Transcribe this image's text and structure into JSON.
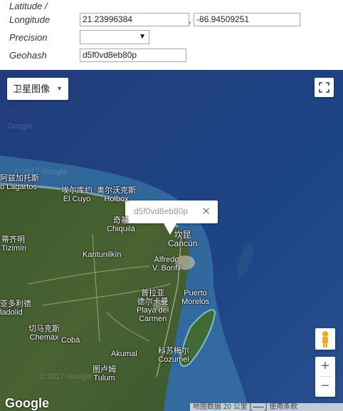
{
  "form": {
    "latlon_label_1": "Latitude /",
    "latlon_label_2": "Longitude",
    "latitude": "21.23996384",
    "longitude": "-86.94509251",
    "comma": ",",
    "precision_label": "Precision",
    "precision_value": "",
    "geohash_label": "Geohash",
    "geohash_value": "d5f0vd8eb80p"
  },
  "map": {
    "type_label": "卫星图像",
    "infowindow_text": "d5f0vd8eb80p",
    "close_glyph": "✕",
    "zoom_in": "+",
    "zoom_out": "−",
    "logo": "Google",
    "attribution": "地图数据   20 公里 ⎣⎯⎯⎯⎦   使用条款",
    "watermarks": [
      "Google",
      "© 2017 Google",
      "© 2017 Google"
    ],
    "places": {
      "p1": "阿兹加托斯",
      "p1b": "o Lagartos",
      "p2": "埃尔库约",
      "p2b": "El Cuyo",
      "p3": "奥尔沃克斯",
      "p3b": "Holbox",
      "p4": "奇基",
      "p4b": "Chiquilá",
      "p5": "坎昆",
      "p5b": "Cancún",
      "p6": "蒂齐明",
      "p6b": "Tizimín",
      "p7": "Kantunilkín",
      "p8": "Alfredo",
      "p8b": "V. Bonfil",
      "p9": "普拉亚",
      "p9b": "德尔卡曼",
      "p9c": "Playa del",
      "p9d": "Carmen",
      "p10": "Puerto",
      "p10b": "Morelos",
      "p11": "亚多利德",
      "p11b": "ladolid",
      "p12": "切马克斯",
      "p12b": "Chemax",
      "p13": "Cobá",
      "p14": "科苏梅尔",
      "p14b": "Cozumel",
      "p15": "Akumal",
      "p16": "图卢姆",
      "p16b": "Tulum"
    }
  }
}
